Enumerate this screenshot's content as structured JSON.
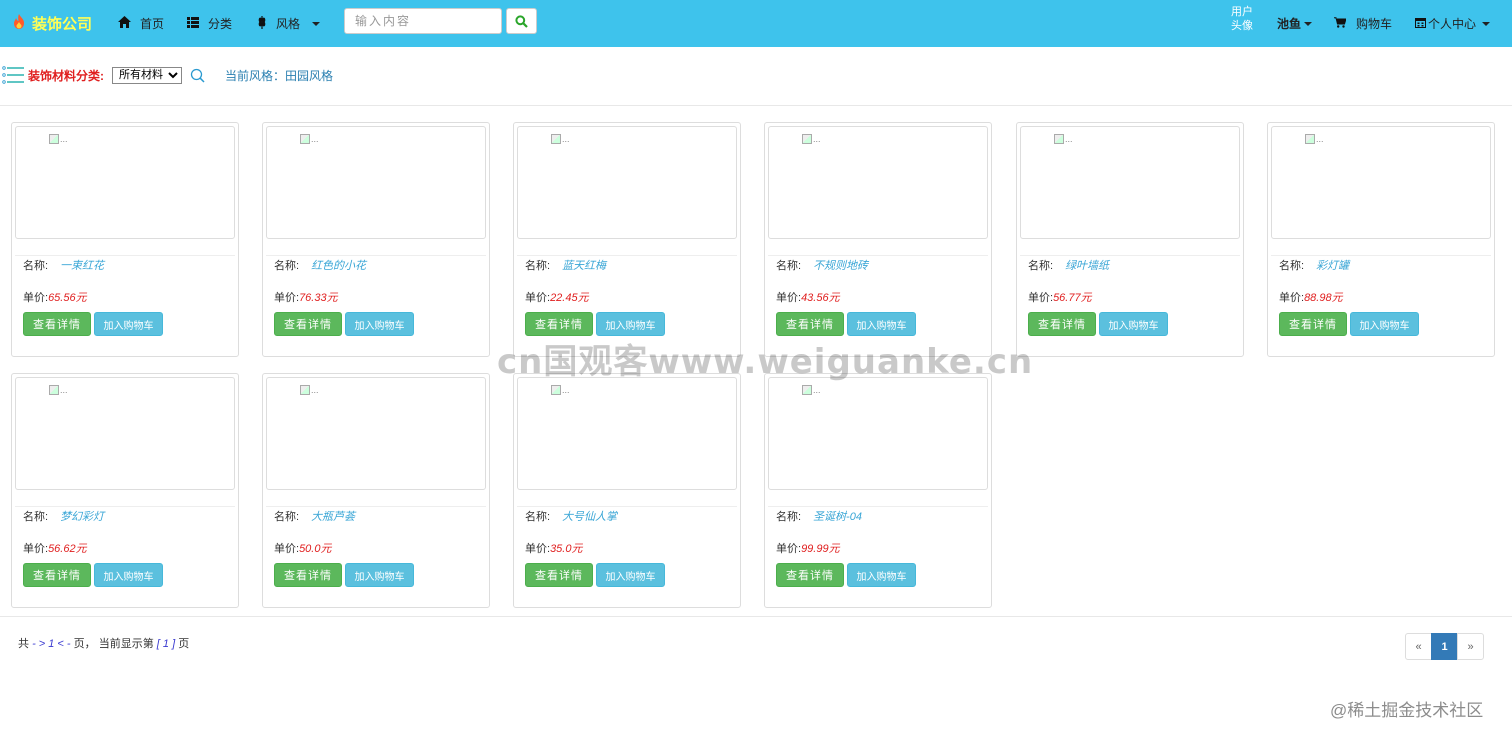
{
  "brand": {
    "title": "装饰公司"
  },
  "nav": {
    "home": "首页",
    "category": "分类",
    "style": "风格",
    "user": "池鱼",
    "cart": "购物车",
    "profile": "个人中心"
  },
  "search": {
    "placeholder": "输入内容"
  },
  "avatar": {
    "alt": "用户头像"
  },
  "filter": {
    "label": "装饰材料分类:",
    "selected": "所有材料",
    "current_style": "当前风格：田园风格"
  },
  "labels": {
    "name": "名称:",
    "price": "单价:",
    "detail_button": "查看详情",
    "cart_button": "加入购物车",
    "broken_image": "..."
  },
  "products": [
    {
      "name": "一束红花",
      "price": "65.56元"
    },
    {
      "name": "红色的小花",
      "price": "76.33元"
    },
    {
      "name": "蓝天红梅",
      "price": "22.45元"
    },
    {
      "name": "不规则地砖",
      "price": "43.56元"
    },
    {
      "name": "绿叶墙纸",
      "price": "56.77元"
    },
    {
      "name": "彩灯罐",
      "price": "88.98元"
    },
    {
      "name": "梦幻彩灯",
      "price": "56.62元"
    },
    {
      "name": "大瓶芦荟",
      "price": "50.0元"
    },
    {
      "name": "大号仙人掌",
      "price": "35.0元"
    },
    {
      "name": "圣诞树-04",
      "price": "99.99元"
    }
  ],
  "pagination": {
    "prefix": "共",
    "total_link": "- > 1 < -",
    "middle": "页，  当前显示第",
    "current_link": "[ 1 ]",
    "suffix": "页",
    "prev": "«",
    "current": "1",
    "next": "»"
  },
  "watermarks": {
    "center": "cn国观客www.weiguanke.cn",
    "corner": "@稀土掘金技术社区"
  },
  "colors": {
    "navbar": "#3ec3ec",
    "brand_text": "#ffff55",
    "detail_button": "#5cb85c",
    "cart_button": "#5bc0de",
    "price": "#e02020",
    "pager_active": "#337ab7"
  }
}
